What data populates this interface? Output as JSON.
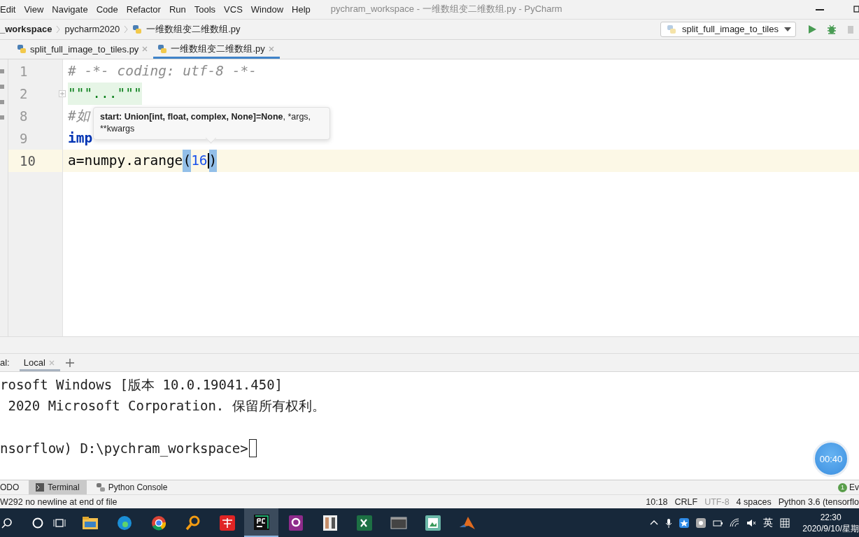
{
  "menu_bar": {
    "items": [
      "Edit",
      "View",
      "Navigate",
      "Code",
      "Refactor",
      "Run",
      "Tools",
      "VCS",
      "Window",
      "Help"
    ],
    "title": "pychram_workspace - 一维数组变二维数组.py - PyCharm"
  },
  "nav_bar": {
    "crumbs": [
      {
        "text": "_workspace",
        "kind": "project"
      },
      {
        "text": "pycharm2020",
        "kind": "folder"
      },
      {
        "text": "一维数组变二维数组.py",
        "kind": "file"
      }
    ],
    "run_config": "split_full_image_to_tiles"
  },
  "editor_tabs": [
    {
      "label": "split_full_image_to_tiles.py",
      "selected": false
    },
    {
      "label": "一维数组变二维数组.py",
      "selected": true
    }
  ],
  "editor": {
    "lines": [
      {
        "number": "1",
        "current": false,
        "tokens": [
          {
            "text": "# -*- coding: utf-8 -*-",
            "kind": "comment"
          }
        ]
      },
      {
        "number": "2",
        "current": false,
        "folded": true,
        "tokens": [
          {
            "text": "\"\"\"...\"\"\"",
            "kind": "docstring"
          }
        ]
      },
      {
        "number": "8",
        "current": false,
        "tokens": [
          {
            "text": "#如",
            "kind": "comment"
          }
        ]
      },
      {
        "number": "9",
        "current": false,
        "tokens": [
          {
            "text": "imp",
            "kind": "keyword"
          }
        ]
      },
      {
        "number": "10",
        "current": true,
        "tokens": [
          {
            "text": "a=numpy.arange",
            "kind": "plain"
          },
          {
            "text": "(",
            "kind": "paren"
          },
          {
            "text": "16",
            "kind": "number"
          },
          {
            "text": ")",
            "kind": "paren"
          }
        ]
      }
    ],
    "tooltip": [
      {
        "text": "start: Union[int, float, complex, None]=None",
        "bold": true
      },
      {
        "text": ", *args, **kwargs",
        "bold": false
      }
    ]
  },
  "terminal": {
    "label": "al:",
    "tabs": [
      {
        "label": "Local",
        "selected": true
      }
    ],
    "lines": [
      "rosoft Windows [版本 10.0.19041.450]",
      " 2020 Microsoft Corporation. 保留所有权利。"
    ],
    "prompt": "nsorflow) D:\\pychram_workspace>"
  },
  "timer": "00:40",
  "tool_tabs": [
    {
      "label": "ODO",
      "selected": false,
      "kind": "text"
    },
    {
      "label": "Terminal",
      "selected": true,
      "kind": "terminal"
    },
    {
      "label": "Python Console",
      "selected": false,
      "kind": "python"
    }
  ],
  "event_log": {
    "count": "1",
    "label": "Ev"
  },
  "status_bar": {
    "message": "W292 no newline at end of file",
    "items": [
      {
        "text": "10:18",
        "disabled": false
      },
      {
        "text": "CRLF",
        "disabled": false
      },
      {
        "text": "UTF-8",
        "disabled": true
      },
      {
        "text": "4 spaces",
        "disabled": false
      },
      {
        "text": "Python 3.6 (tensorflo",
        "disabled": false
      }
    ]
  },
  "taskbar": {
    "apps": [
      {
        "kind": "folder",
        "selected": false
      },
      {
        "kind": "edge",
        "selected": false
      },
      {
        "kind": "chrome",
        "selected": false
      },
      {
        "kind": "search",
        "selected": false
      },
      {
        "kind": "dict",
        "selected": false
      },
      {
        "kind": "pycharm",
        "selected": true
      },
      {
        "kind": "pdf",
        "selected": false
      },
      {
        "kind": "figure",
        "selected": false
      },
      {
        "kind": "excel",
        "selected": false
      },
      {
        "kind": "console",
        "selected": false
      },
      {
        "kind": "image",
        "selected": false
      },
      {
        "kind": "matlab",
        "selected": false
      }
    ],
    "ime": "英",
    "time": "22:30",
    "date": "2020/9/10/星期"
  }
}
